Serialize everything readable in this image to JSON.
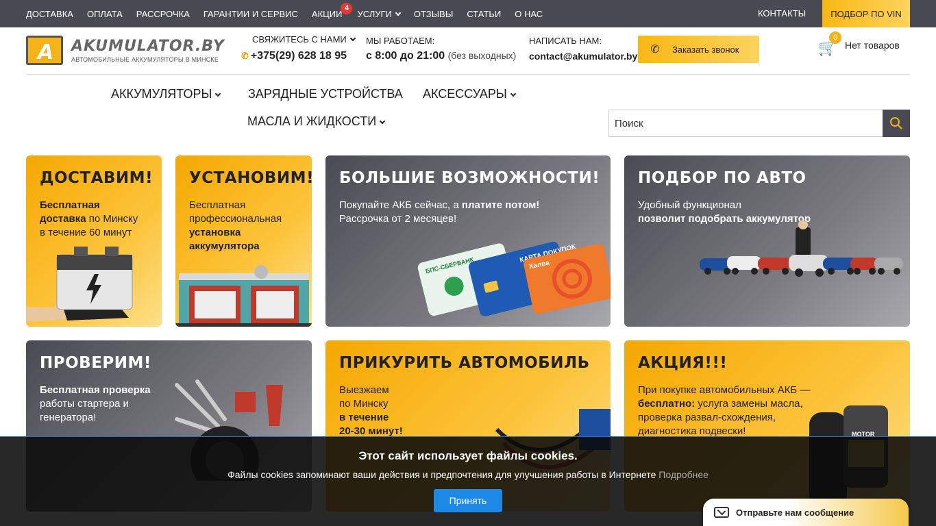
{
  "topnav": {
    "items": [
      {
        "label": "ДОСТАВКА"
      },
      {
        "label": "ОПЛАТА"
      },
      {
        "label": "РАССРОЧКА"
      },
      {
        "label": "ГАРАНТИИ И СЕРВИС"
      },
      {
        "label": "АКЦИИ",
        "badge": "4"
      },
      {
        "label": "УСЛУГИ"
      },
      {
        "label": "ОТЗЫВЫ"
      },
      {
        "label": "СТАТЬИ"
      },
      {
        "label": "О НАС"
      }
    ],
    "contacts": "КОНТАКТЫ",
    "vin": "ПОДБОР ПО VIN"
  },
  "logo": {
    "name": "AKUMULATOR.BY",
    "letter": "A",
    "tagline": "АВТОМОБИЛЬНЫЕ АККУМУЛЯТОРЫ В МИНСКЕ"
  },
  "header": {
    "contact_label": "СВЯЖИТЕСЬ С НАМИ",
    "phone": "+375(29) 628 18 95",
    "hours_label": "МЫ РАБОТАЕМ:",
    "hours": "с 8:00 до 21:00",
    "hours_note": "(без выходных)",
    "email_label": "НАПИСАТЬ НАМ:",
    "email": "contact@akumulator.by",
    "call_button": "Заказать звонок",
    "cart_count": "0",
    "cart_text": "Нет товаров"
  },
  "mainnav": {
    "batteries": "АККУМУЛЯТОРЫ",
    "chargers": "ЗАРЯДНЫЕ УСТРОЙСТВА",
    "accessories": "АКСЕССУАРЫ",
    "oils": "МАСЛА И ЖИДКОСТИ"
  },
  "search": {
    "placeholder": "Поиск"
  },
  "cards": {
    "delivery": {
      "title": "ДОСТАВИМ!",
      "l1b": "Бесплатная",
      "l2b": "доставка",
      "l2": " по Минску",
      "l3": "в течение 60 минут"
    },
    "install": {
      "title": "УСТАНОВИМ!",
      "l1": "Бесплатная",
      "l2": "профессиональная",
      "l3b": "установка",
      "l4b": "аккумулятора"
    },
    "credit": {
      "title": "БОЛЬШИЕ ВОЗМОЖНОСТИ!",
      "l1": "Покупайте АКБ сейчас, а ",
      "l1b": "платите потом!",
      "l2": "Рассрочка от 2 месяцев!",
      "card1": "БПС-СБЕРБАНК",
      "card2": "КАРТА ПОКУПОК",
      "card3": "Халва"
    },
    "auto": {
      "title": "ПОДБОР ПО АВТО",
      "l1": "Удобный функционал",
      "l2b": "позволит подобрать аккумулятор"
    },
    "check": {
      "title": "ПРОВЕРИМ!",
      "l1b": "Бесплатная проверка",
      "l2": "работы стартера и",
      "l3": "генератора!"
    },
    "jump": {
      "title": "ПРИКУРИТЬ АВТОМОБИЛЬ",
      "l1": "Выезжаем",
      "l2": "по Минску",
      "l3b": "в течение",
      "l4b": "20-30 минут!"
    },
    "promo": {
      "title": "АКЦИЯ!!!",
      "l1": "При покупке автомобильных АКБ —",
      "l2b": "бесплатно:",
      "l2": " услуга замены масла,",
      "l3": "проверка развал-схождения,",
      "l4": "диагностика подвески!",
      "can_label": "MOTOR"
    }
  },
  "cookie": {
    "title": "Этот сайт использует файлы cookies.",
    "text": "Файлы cookies запоминают ваши действия и предпочтения для улучшения работы в Интернете",
    "more": "Подробнее",
    "accept": "Принять"
  },
  "chat": {
    "label": "Отправьте нам сообщение"
  },
  "colors": {
    "accent": "#f6b316",
    "dark": "#4a4a52",
    "badge": "#e53935",
    "button_blue": "#1e88e5"
  }
}
